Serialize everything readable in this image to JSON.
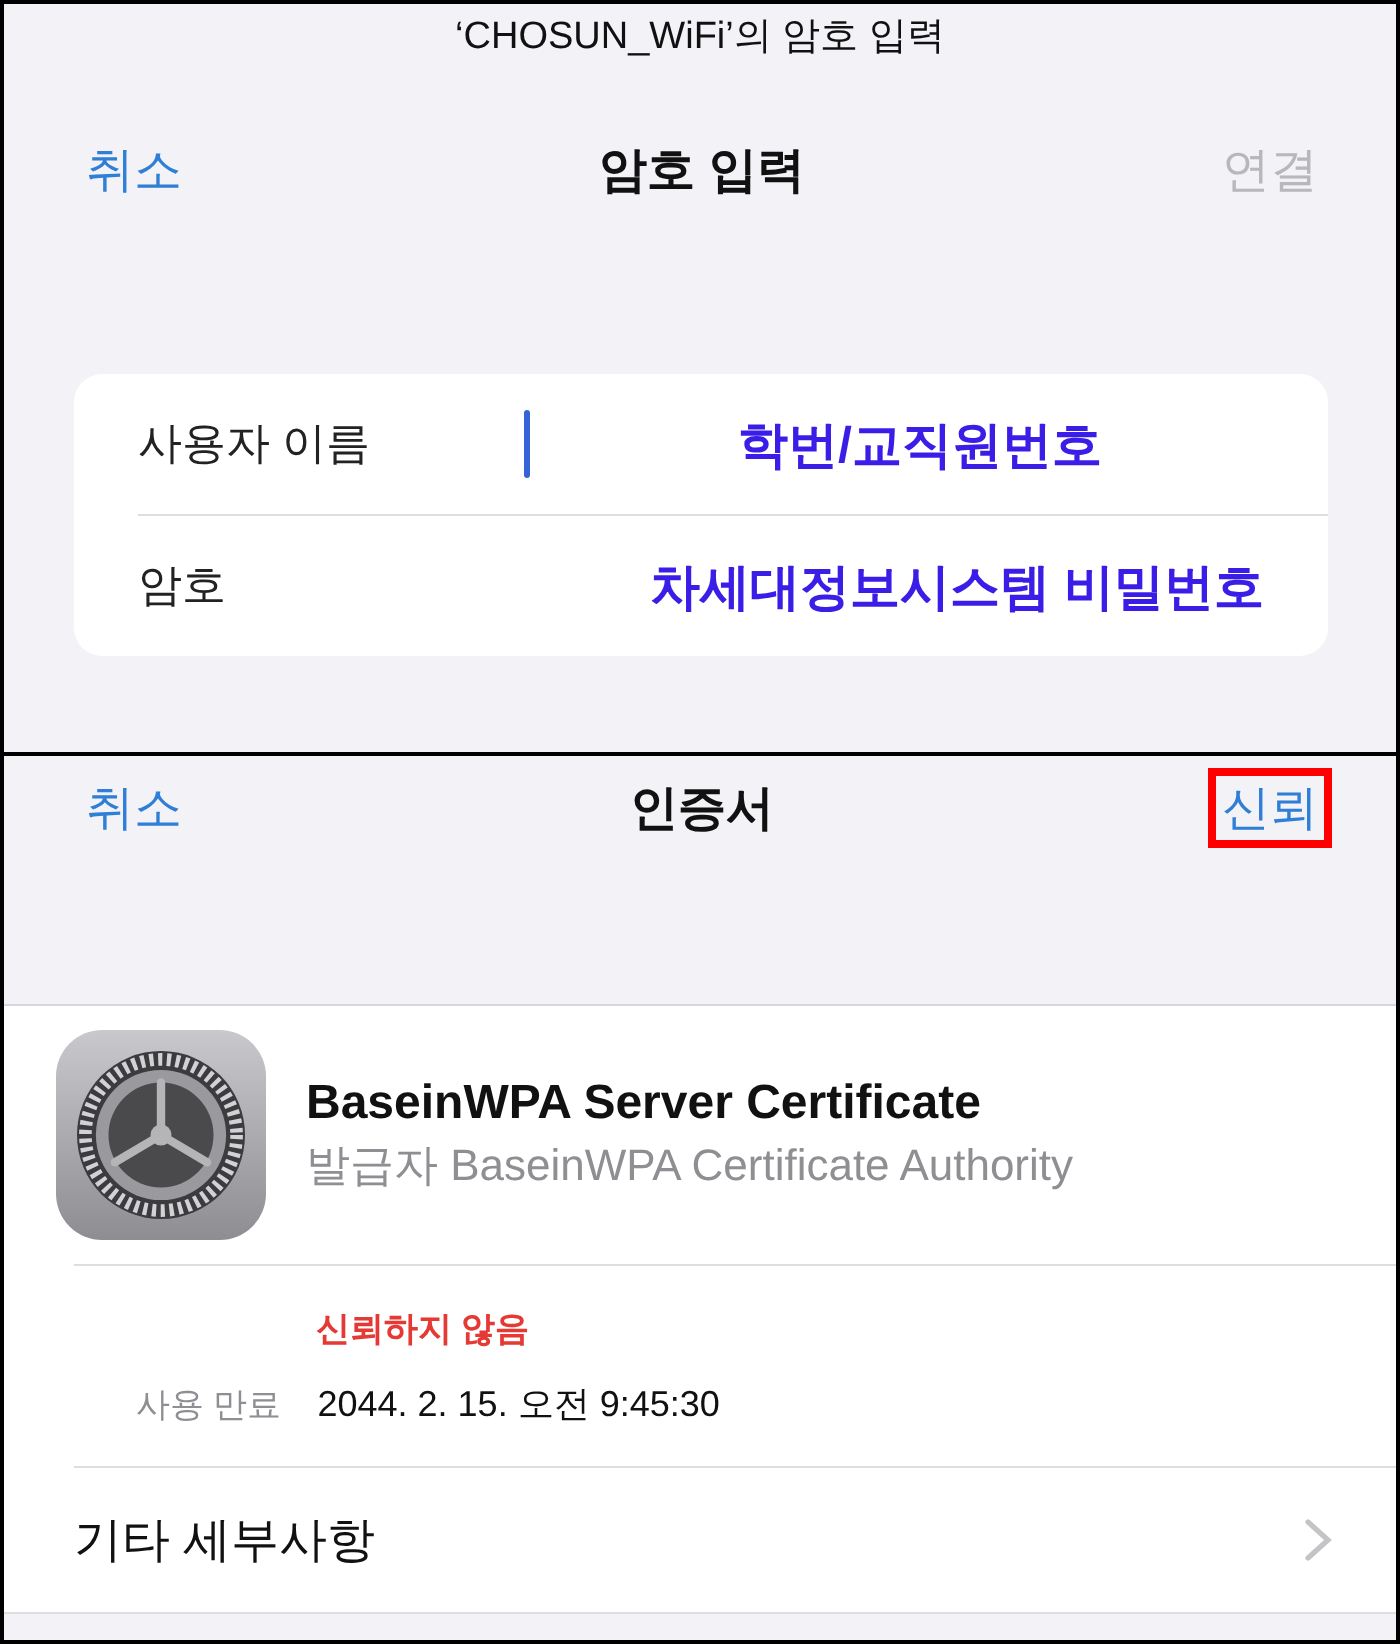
{
  "password_screen": {
    "prompt": "‘CHOSUN_WiFi’의 암호 입력",
    "nav": {
      "left": {
        "label": "취소",
        "disabled": false
      },
      "title": "암호 입력",
      "right": {
        "label": "연결",
        "disabled": true,
        "highlighted": false
      }
    },
    "fields": [
      {
        "label": "사용자 이름",
        "focused": true,
        "annotation": "학번/교직원번호"
      },
      {
        "label": "암호",
        "focused": false,
        "annotation": "차세대정보시스템 비밀번호"
      }
    ]
  },
  "certificate_screen": {
    "nav": {
      "left": {
        "label": "취소",
        "disabled": false
      },
      "title": "인증서",
      "right": {
        "label": "신뢰",
        "disabled": false,
        "highlighted": true
      }
    },
    "certificate": {
      "name": "BaseinWPA Server Certificate",
      "issuer": "발급자 BaseinWPA Certificate Authority"
    },
    "trust_status": "신뢰하지 않음",
    "expiry": {
      "label": "사용 만료",
      "value": "2044. 2. 15. 오전 9:45:30"
    },
    "more_details": "기타 세부사항"
  }
}
